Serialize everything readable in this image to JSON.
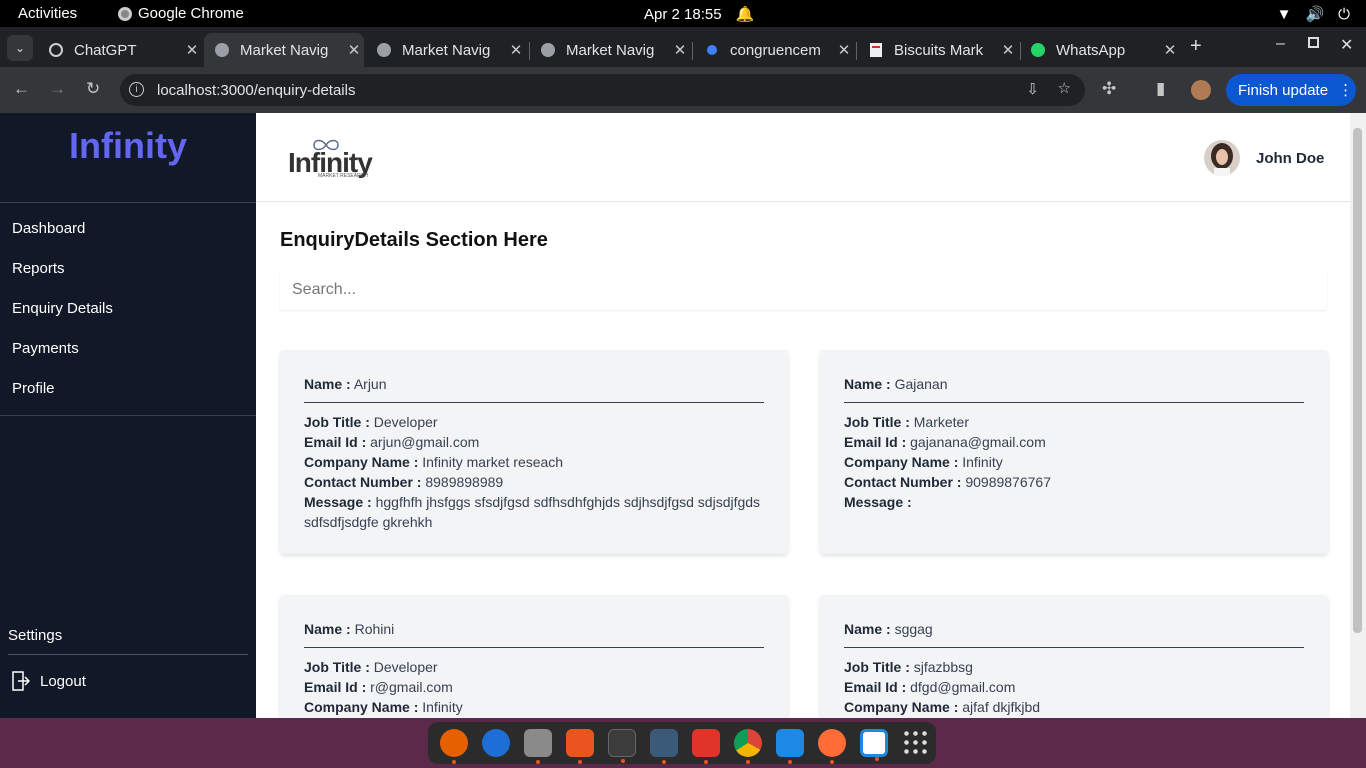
{
  "topbar": {
    "activities": "Activities",
    "app_name": "Google Chrome",
    "clock": "Apr 2  18:55"
  },
  "tabs": [
    {
      "title": "ChatGPT",
      "active": false
    },
    {
      "title": "Market Navig",
      "active": true
    },
    {
      "title": "Market Navig",
      "active": false
    },
    {
      "title": "Market Navig",
      "active": false
    },
    {
      "title": "congruencem",
      "active": false
    },
    {
      "title": "Biscuits Mark",
      "active": false
    },
    {
      "title": "WhatsApp",
      "active": false
    }
  ],
  "address": {
    "url": "localhost:3000/enquiry-details",
    "update_label": "Finish update"
  },
  "sidebar": {
    "brand": "Infinity",
    "items": [
      "Dashboard",
      "Reports",
      "Enquiry Details",
      "Payments",
      "Profile"
    ],
    "settings": "Settings",
    "logout": "Logout"
  },
  "header": {
    "logo_text": "Infinity",
    "logo_subtext": "MARKET RESEARCH",
    "user_name": "John Doe"
  },
  "main": {
    "title": "EnquiryDetails Section Here",
    "search_placeholder": "Search...",
    "labels": {
      "name": "Name :",
      "job_title": "Job Title :",
      "email": "Email Id :",
      "company": "Company Name :",
      "contact": "Contact Number :",
      "message": "Message :"
    },
    "enquiries": [
      {
        "name": "Arjun",
        "job_title": "Developer",
        "email": "arjun@gmail.com",
        "company": "Infinity market reseach",
        "contact": "8989898989",
        "message": "hggfhfh jhsfggs sfsdjfgsd sdfhsdhfghjds sdjhsdjfgsd sdjsdjfgds sdfsdfjsdgfe gkrehkh"
      },
      {
        "name": "Gajanan",
        "job_title": "Marketer",
        "email": "gajanana@gmail.com",
        "company": "Infinity",
        "contact": "90989876767",
        "message": ""
      },
      {
        "name": "Rohini",
        "job_title": "Developer",
        "email": "r@gmail.com",
        "company": "Infinity",
        "contact": "",
        "message": ""
      },
      {
        "name": "sggag",
        "job_title": "sjfazbbsg",
        "email": "dfgd@gmail.com",
        "company": "ajfaf dkjfkjbd",
        "contact": "",
        "message": ""
      }
    ]
  },
  "colors": {
    "sidebar_bg": "#111827",
    "brand": "#6366f1",
    "card_bg": "#f3f4f6",
    "chrome_dark": "#202124",
    "update_button": "#0b57d0"
  }
}
